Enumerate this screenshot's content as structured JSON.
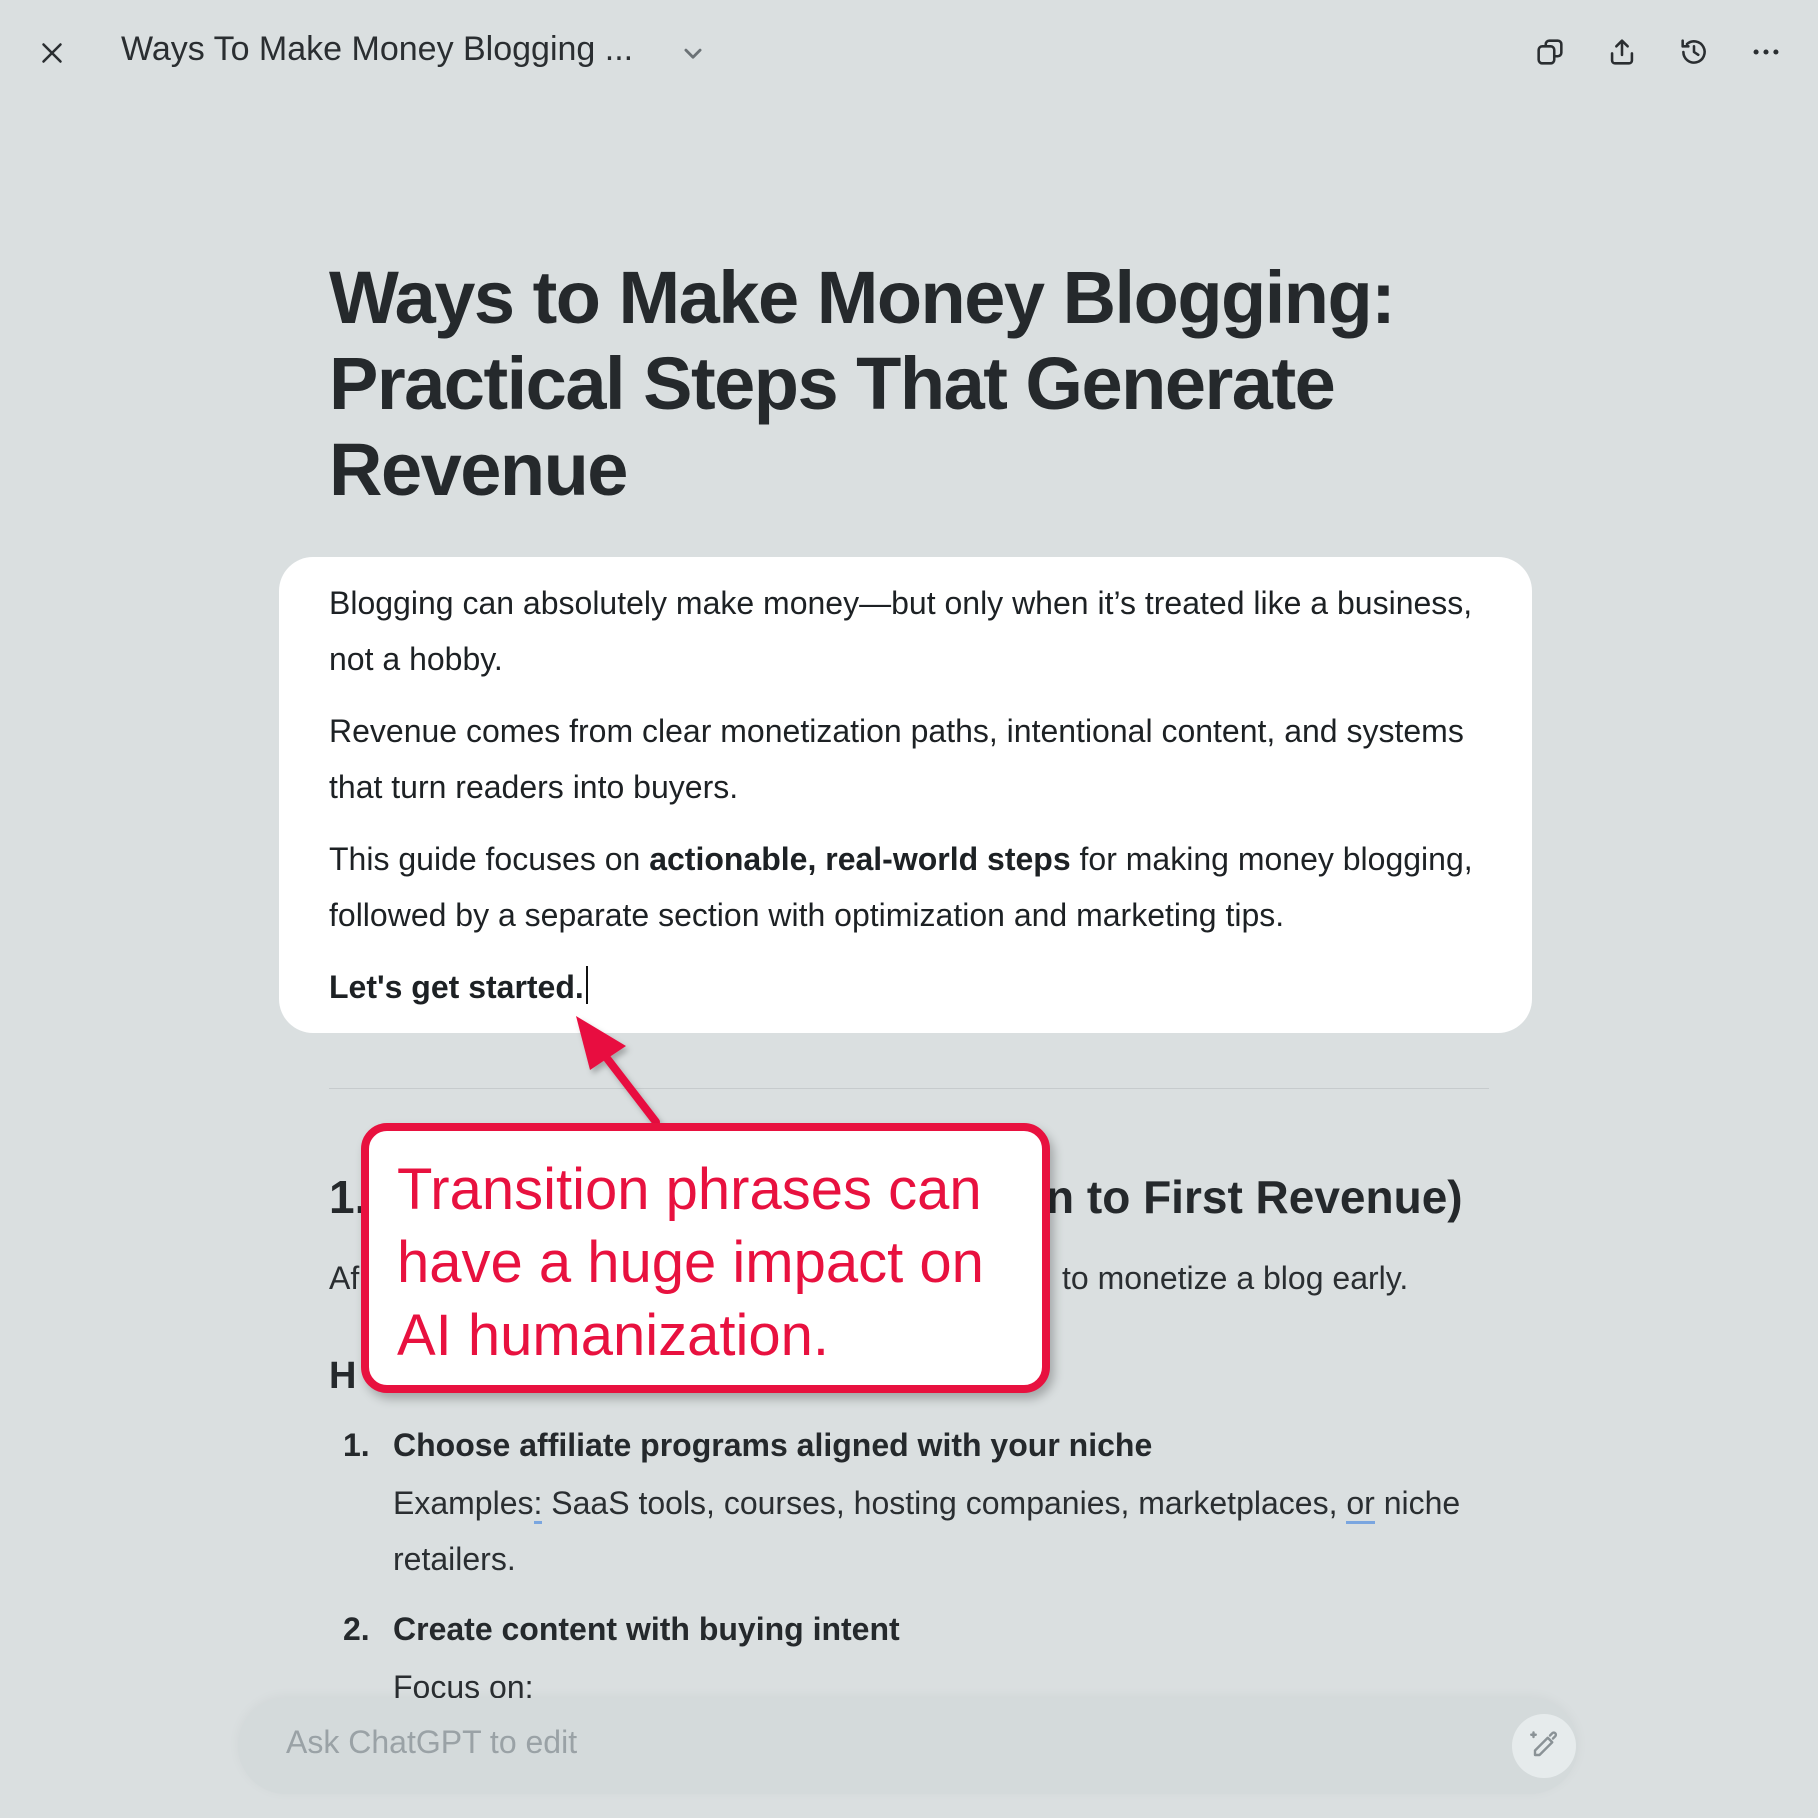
{
  "header": {
    "title": "Ways To Make Money Blogging ...",
    "close_icon": "close-icon",
    "chevron_icon": "chevron-down-icon",
    "actions": [
      "copy-icon",
      "share-icon",
      "history-icon",
      "more-icon"
    ]
  },
  "document": {
    "title": "Ways to Make Money Blogging: Practical Steps That Generate Revenue",
    "intro": {
      "p1": "Blogging can absolutely make money—but only when it’s treated like a business, not a hobby.",
      "p2": "Revenue comes from clear monetization paths, intentional content, and systems that turn readers into buyers.",
      "p3_pre": "This guide focuses on ",
      "p3_bold": "actionable, real-world steps",
      "p3_post": " for making money blogging, followed by a separate section with optimization and marketing tips.",
      "p4": "Let's get started."
    },
    "section1": {
      "heading_start": "1.",
      "heading_end": "n to First Revenue)",
      "body_start": "Af",
      "body_end": "to monetize a blog early.",
      "subheading_start": "H",
      "items": [
        {
          "num": "1.",
          "title": "Choose affiliate programs aligned with your niche",
          "body_a": "Examples",
          "body_b": ":",
          "body_c": " SaaS tools, courses, hosting companies, marketplaces, ",
          "body_d": "or",
          "body_e": " niche retailers."
        },
        {
          "num": "2.",
          "title": "Create content with buying intent",
          "body": "Focus on:"
        }
      ]
    }
  },
  "annotation": {
    "text": "Transition phrases can have a huge impact on AI humanization.",
    "color": "#e8113f"
  },
  "composer": {
    "placeholder": "Ask ChatGPT to edit",
    "icon": "pencil-sparkle-icon"
  }
}
